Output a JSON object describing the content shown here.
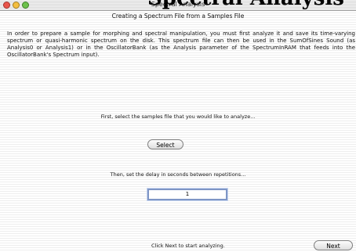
{
  "overlay": {
    "partial_title": "Spectral Analysis"
  },
  "window": {
    "title": "Spectral Analysis"
  },
  "page": {
    "heading": "Creating a Spectrum File from a Samples File",
    "intro": "In order to prepare a sample for morphing and spectral manipulation, you must first analyze it and save its time-varying spectrum or quasi-harmonic spectrum on the disk. This spectrum file can then be used in the SumOfSines Sound (as Analysis0 or Analysis1) or in the OscillatorBank (as the Analysis parameter of the SpectrumInRAM that feeds into the OscillatorBank's Spectrum input).",
    "select_prompt": "First, select the samples file that you would like to analyze...",
    "select_button": "Select",
    "delay_prompt": "Then, set the delay in seconds between repetitions...",
    "delay_value": "1",
    "footer_message": "Click Next to start analyzing.",
    "next_button": "Next"
  }
}
